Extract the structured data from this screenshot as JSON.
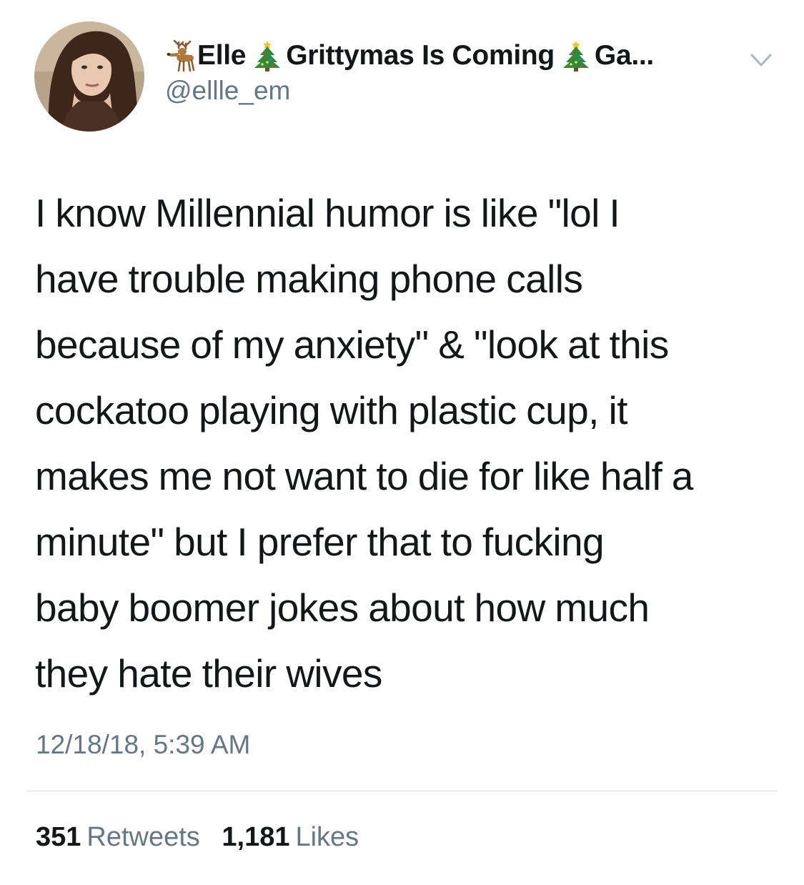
{
  "profile": {
    "display_name_parts": [
      "Elle",
      "Grittymas Is Coming",
      "Ga..."
    ],
    "handle": "@ellle_em"
  },
  "tweet": {
    "lines": [
      "I know Millennial humor is like \"lol I",
      "have trouble making phone calls",
      "because of my anxiety\" & \"look at this",
      "cockatoo playing with plastic cup, it",
      "makes me not want to die for like half a",
      "minute\" but I prefer that to fucking",
      "baby boomer jokes about how much",
      "they hate their wives"
    ],
    "timestamp": "12/18/18, 5:39 AM"
  },
  "stats": {
    "retweets_count": "351",
    "retweets_label": "Retweets",
    "likes_count": "1,181",
    "likes_label": "Likes"
  },
  "icons": {
    "deer": "deer-icon",
    "tree": "christmas-tree-icon",
    "menu": "chevron-down-icon"
  },
  "colors": {
    "text": "#14171a",
    "secondary": "#657786",
    "divider": "#d6dce0",
    "chevron": "#aab8c2"
  }
}
